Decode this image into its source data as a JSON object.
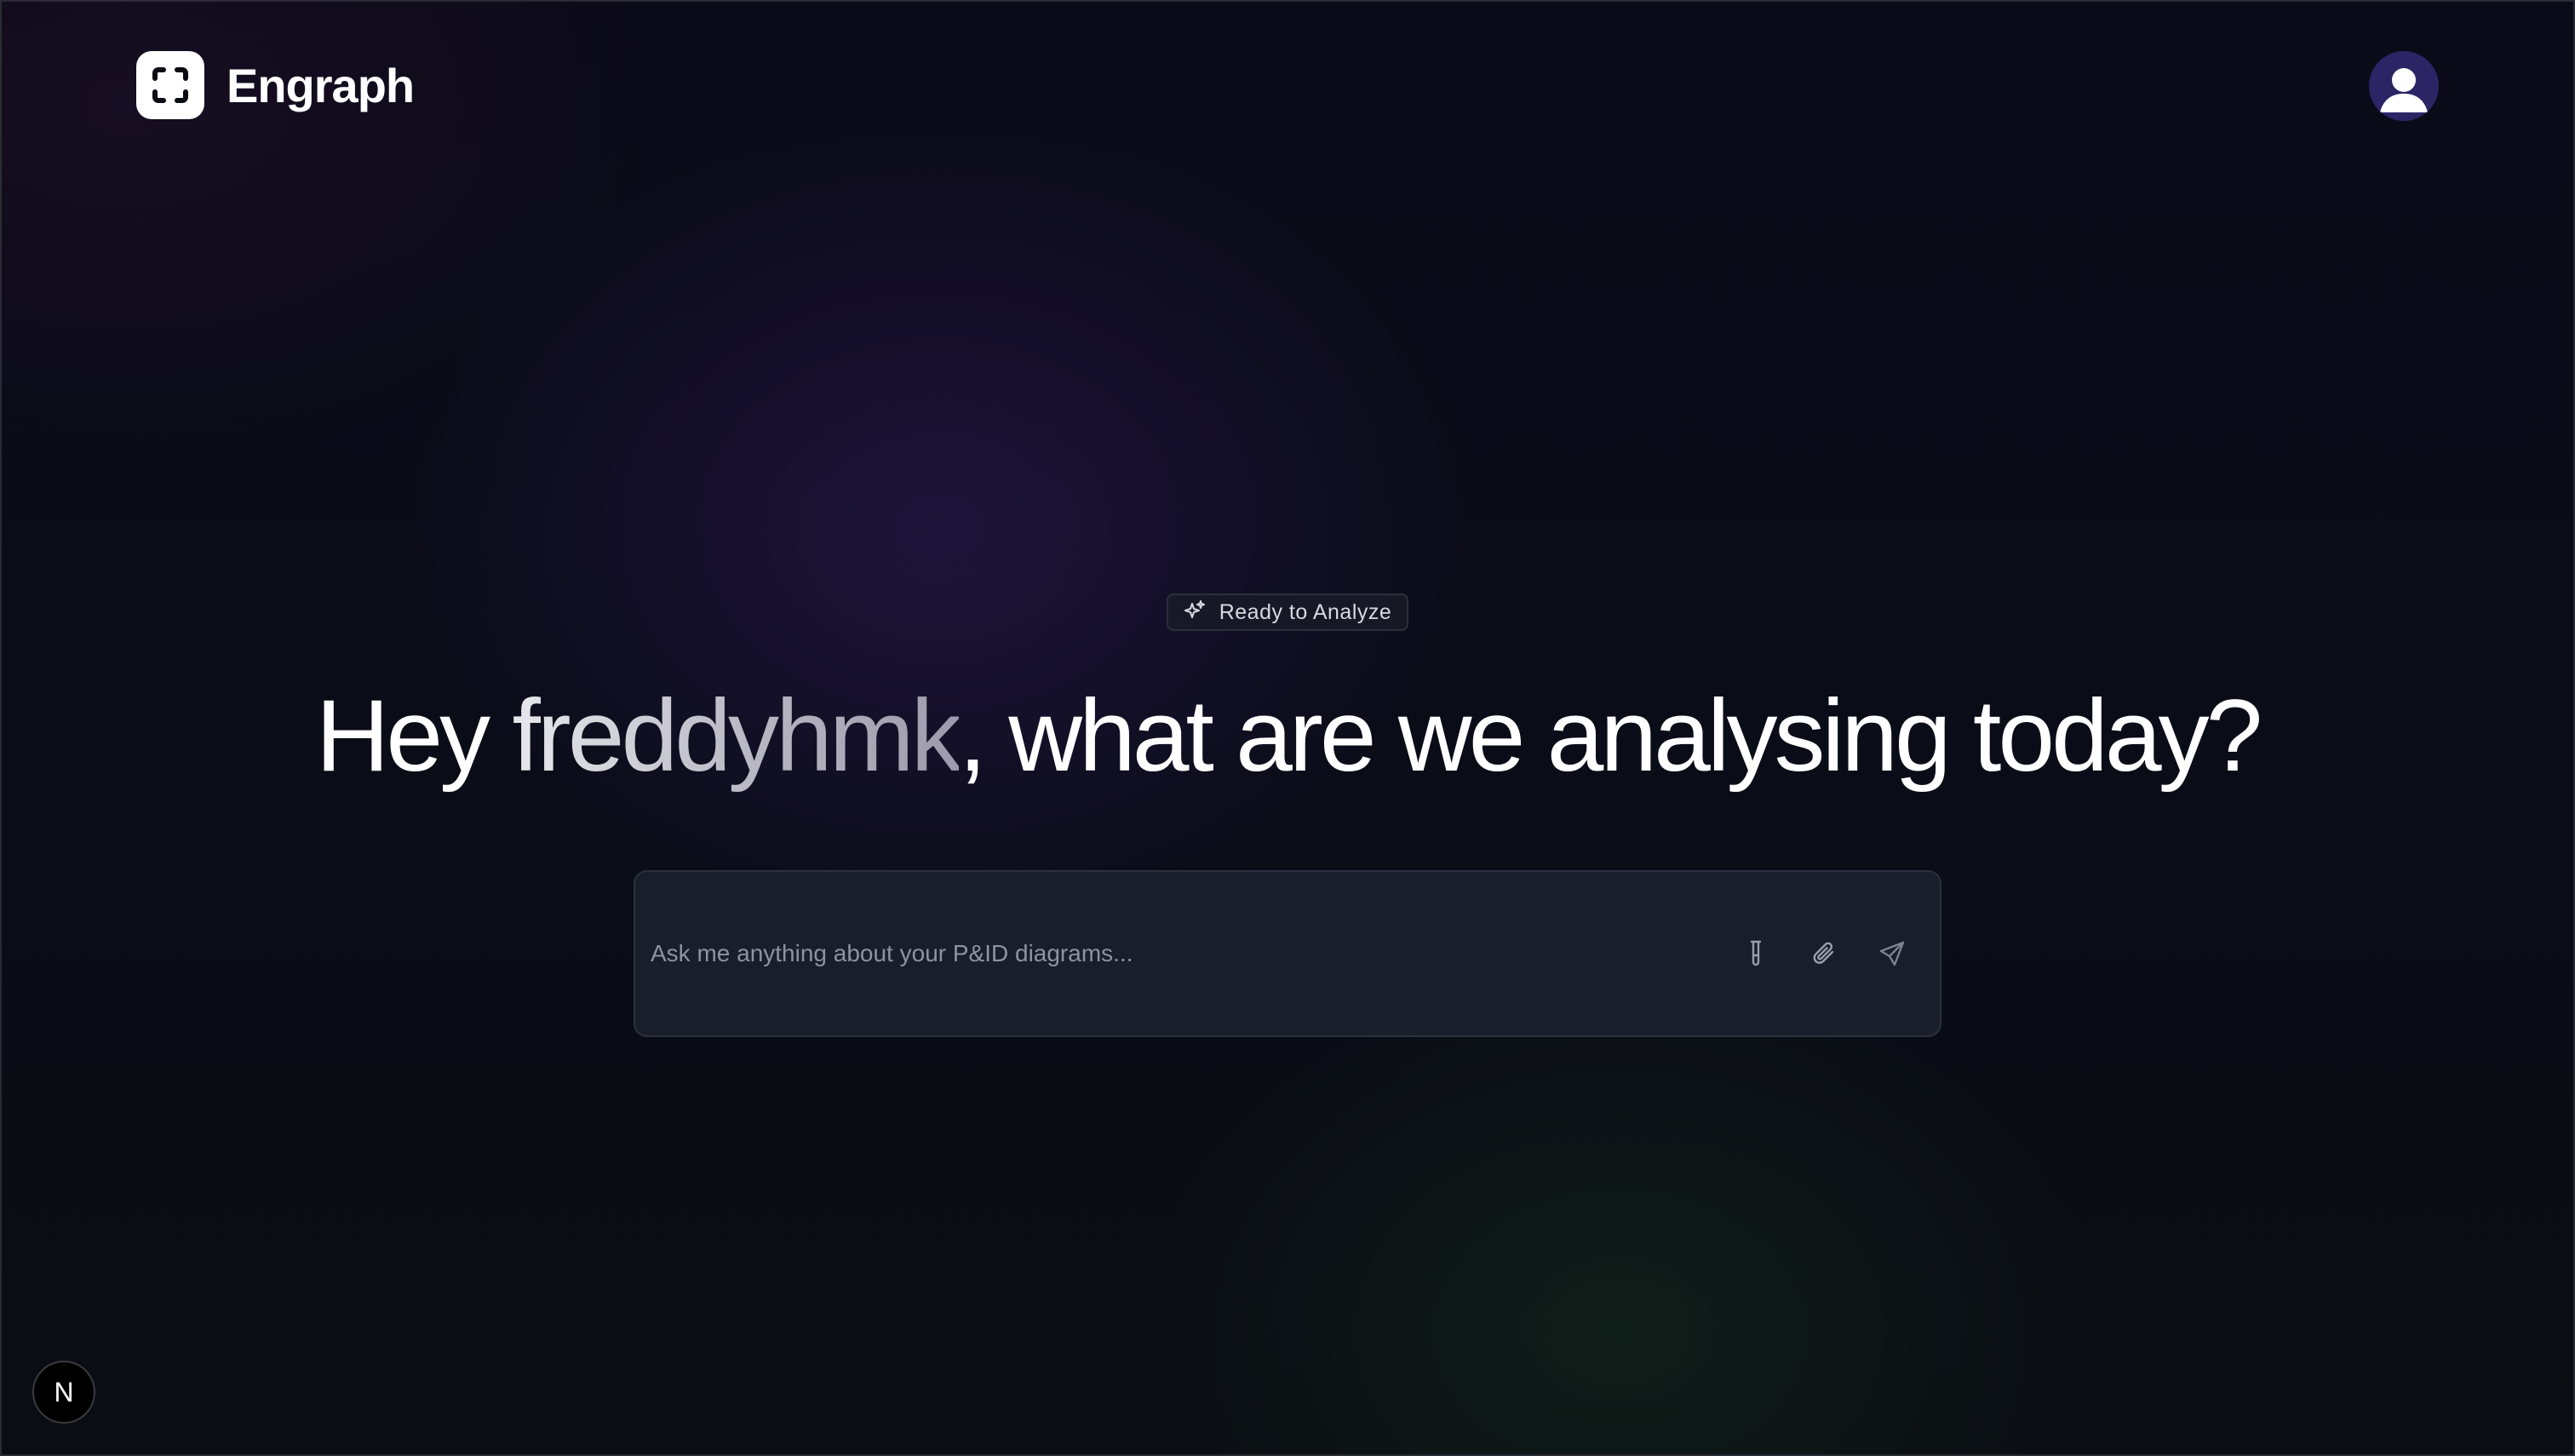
{
  "header": {
    "brand_name": "Engraph",
    "logo_icon": "scan-frame-icon",
    "avatar_icon": "user-avatar-icon"
  },
  "main": {
    "status_badge": {
      "icon": "sparkles-icon",
      "label": "Ready to Analyze"
    },
    "greeting": {
      "prefix": "Hey ",
      "username": "freddyhmk",
      "suffix": ", what are we analysing today?"
    },
    "chat": {
      "placeholder": "Ask me anything about your P&ID diagrams...",
      "value": "",
      "tools": [
        "test-tube-icon",
        "paperclip-icon",
        "send-icon"
      ]
    }
  },
  "dev_badge": {
    "label": "N"
  },
  "colors": {
    "background": "#0a0b14",
    "chat_box": "#1a1e2a",
    "avatar": "#2b2566",
    "text": "#ffffff",
    "placeholder": "#8f93a1"
  }
}
